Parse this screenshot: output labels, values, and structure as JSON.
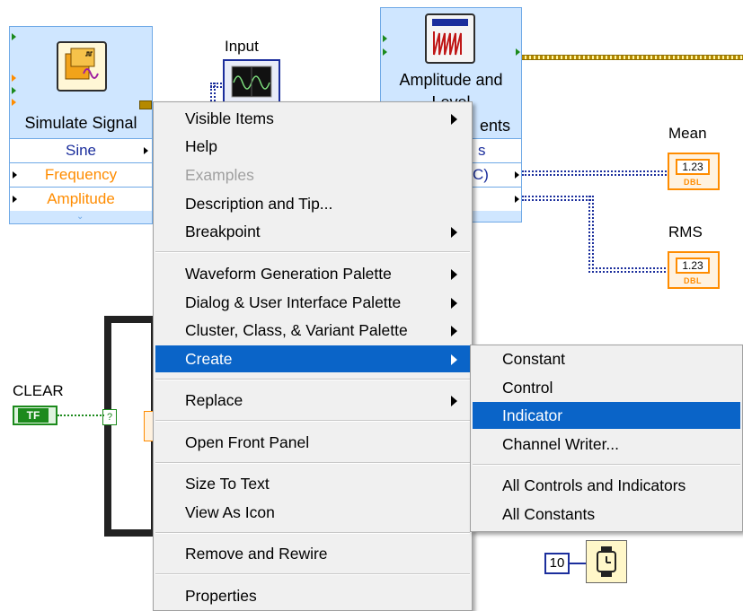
{
  "diagram": {
    "simulate_signal": {
      "title": "Simulate Signal",
      "props": [
        "Sine",
        "Frequency",
        "Amplitude"
      ],
      "icon": "simulate-signal-icon"
    },
    "amplitude_node": {
      "title_line1": "Amplitude and",
      "title_line2": "Level",
      "title_line3": "ents",
      "prop_fragment1": "s",
      "prop_fragment2": "C)",
      "icon": "amplitude-measurements-icon"
    },
    "input_label": "Input",
    "mean_label": "Mean",
    "rms_label": "RMS",
    "indicator_value": "1.23",
    "indicator_type": "DBL",
    "clear_label": "CLEAR",
    "clear_const": "TF",
    "wait_constant": "10",
    "colors": {
      "node_bg": "#cfe6ff",
      "dbl_wire": "#1b2e9c",
      "numeric_orange": "#ff8c00",
      "bool_green": "#1c8a1c",
      "menu_highlight": "#0a64c8"
    }
  },
  "context_menu": {
    "items": [
      {
        "label": "Visible Items",
        "submenu": true
      },
      {
        "label": "Help",
        "submenu": false
      },
      {
        "label": "Examples",
        "submenu": false,
        "disabled": true
      },
      {
        "label": "Description and Tip...",
        "submenu": false
      },
      {
        "label": "Breakpoint",
        "submenu": true
      },
      {
        "label": "Waveform Generation Palette",
        "submenu": true
      },
      {
        "label": "Dialog & User Interface Palette",
        "submenu": true
      },
      {
        "label": "Cluster, Class, & Variant Palette",
        "submenu": true
      },
      {
        "label": "Create",
        "submenu": true,
        "selected": true
      },
      {
        "label": "Replace",
        "submenu": true
      },
      {
        "label": "Open Front Panel",
        "submenu": false
      },
      {
        "label": "Size To Text",
        "submenu": false
      },
      {
        "label": "View As Icon",
        "submenu": false
      },
      {
        "label": "Remove and Rewire",
        "submenu": false
      },
      {
        "label": "Properties",
        "submenu": false
      }
    ]
  },
  "create_submenu": {
    "items": [
      {
        "label": "Constant"
      },
      {
        "label": "Control"
      },
      {
        "label": "Indicator",
        "selected": true
      },
      {
        "label": "Channel Writer..."
      },
      {
        "label": "All Controls and Indicators"
      },
      {
        "label": "All Constants"
      }
    ]
  }
}
